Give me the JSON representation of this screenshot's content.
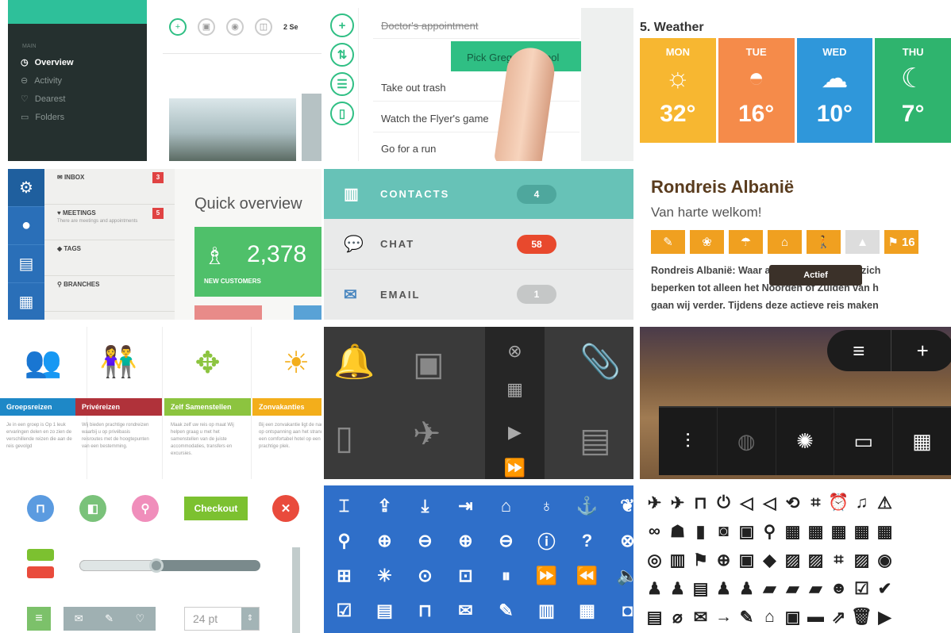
{
  "nav_panel": {
    "section_label": "MAIN",
    "items": [
      {
        "label": "Overview",
        "icon": "clock-icon",
        "active": true
      },
      {
        "label": "Activity",
        "icon": "activity-icon",
        "active": false
      },
      {
        "label": "Dearest",
        "icon": "heart-icon",
        "active": false
      },
      {
        "label": "Folders",
        "icon": "folder-icon",
        "active": false
      }
    ]
  },
  "toolbar_panel": {
    "time_label": "2 Se"
  },
  "todo_panel": {
    "items": [
      "Doctor's appointment",
      "Take out trash",
      "Watch the Flyer's game",
      "Go for a run"
    ],
    "dragged_item": "Pick Greg up school"
  },
  "weather": {
    "title": "5. Weather",
    "days": [
      {
        "name": "MON",
        "temp": "32°",
        "icon": "sun-icon",
        "color": "#f7b731"
      },
      {
        "name": "TUE",
        "temp": "16°",
        "icon": "sunset-icon",
        "color": "#f58b4a"
      },
      {
        "name": "WED",
        "temp": "10°",
        "icon": "cloud-icon",
        "color": "#2f97da"
      },
      {
        "name": "THU",
        "temp": "7°",
        "icon": "moon-icon",
        "color": "#2fb46e"
      }
    ]
  },
  "dashboard": {
    "menu": [
      {
        "label": "INBOX",
        "badge": "3",
        "sub": ""
      },
      {
        "label": "MEETINGS",
        "badge": "5",
        "sub": "There are meetings and appointments"
      },
      {
        "label": "TAGS",
        "badge": "",
        "sub": ""
      },
      {
        "label": "BRANCHES",
        "badge": "",
        "sub": ""
      }
    ],
    "overview_title": "Quick overview",
    "card_value": "2,378",
    "card_label": "NEW CUSTOMERS"
  },
  "contacts_panel": {
    "rows": [
      {
        "label": "CONTACTS",
        "count": "4",
        "pill_color": "#4ea79d"
      },
      {
        "label": "CHAT",
        "count": "58",
        "pill_color": "#e8492d"
      },
      {
        "label": "EMAIL",
        "count": "1",
        "pill_color": "#c5c7c7"
      }
    ]
  },
  "tour": {
    "title": "Rondreis Albanië",
    "subtitle": "Van harte welkom!",
    "badge_count": "16",
    "tooltip": "Actief",
    "text_lines": [
      "Rondreis Albanië: Waar andere organisaties zich",
      "beperken tot alleen het Noorden of Zuiden van h",
      "gaan wij verder. Tijdens deze actieve reis maken"
    ]
  },
  "travel_types": [
    {
      "label": "Groepsreizen",
      "color": "#1e88c7",
      "text": "Je in een groep is Op 1 leuk ervaringen delen en zo zien de verschillende reizen die aan de reis gevolgd"
    },
    {
      "label": "Privéreizen",
      "color": "#b0323a",
      "text": "Wij bieden prachtige rondreizen waarbij u op privébasis reisroutes met de hoogtepunten van een bestemming."
    },
    {
      "label": "Zelf Samenstellen",
      "color": "#8cc43f",
      "text": "Maak zelf uw reis op maat Wij helpen graag u met het samenstellen van de juiste accommodaties, transfers en excursies."
    },
    {
      "label": "Zonvakanties",
      "color": "#f3ae1b",
      "text": "Bij een zonvakantie ligt de nadruk op ontspanning aan het strand en een comfortabel hotel op een prachtige plek."
    }
  ],
  "controls": {
    "checkout_label": "Checkout",
    "font_size_value": "24 pt",
    "colors": {
      "blue": "#5b9be0",
      "green": "#7ac27a",
      "pink": "#f08ebb",
      "red": "#e94b3c"
    }
  }
}
